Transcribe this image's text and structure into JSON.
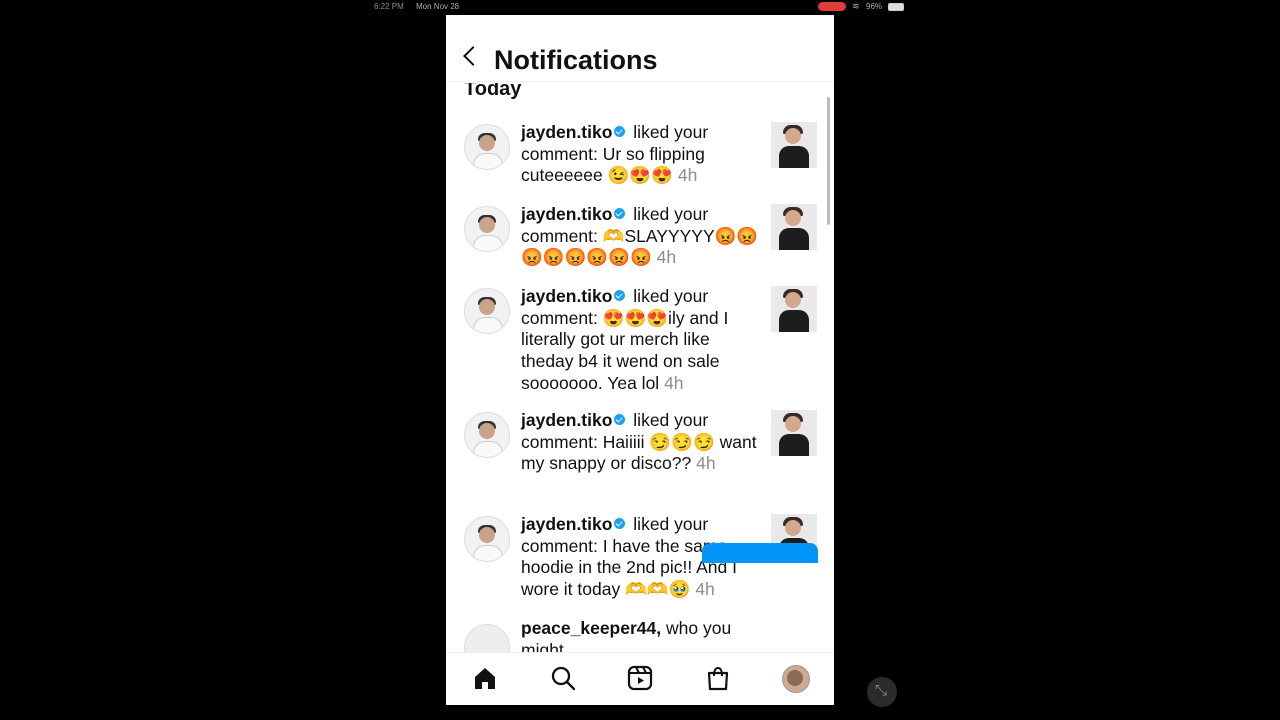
{
  "status_bar": {
    "time": "6:22 PM",
    "date": "Mon Nov 28",
    "battery": "96%"
  },
  "header": {
    "title": "Notifications"
  },
  "section": {
    "title": "Today"
  },
  "notifications": [
    {
      "username": "jayden.tiko",
      "action": "liked your comment: Ur so flipping cuteeeeee 😉😍😍",
      "time": "4h"
    },
    {
      "username": "jayden.tiko",
      "action": "liked your comment: 🫶SLAYYYYY😡😡😡😡😡😡😡😡",
      "time": "4h"
    },
    {
      "username": "jayden.tiko",
      "action": "liked your comment: 😍😍😍ily and I literally got ur merch like theday b4 it wend on sale sooooooo. Yea lol",
      "time": "4h"
    },
    {
      "username": "jayden.tiko",
      "action": "liked your comment: Haiiiii 😏😏😏 want my snappy or disco??",
      "time": "4h"
    },
    {
      "username": "jayden.tiko",
      "action": "liked your comment: I have the same hoodie in the 2nd pic!! And I wore it today 🫶🫶🥹",
      "time": "4h"
    },
    {
      "username": "peace_keeper44,",
      "action": "who you might",
      "time": ""
    }
  ],
  "tabbar": {
    "items": [
      "home-icon",
      "search-icon",
      "reels-icon",
      "shop-icon",
      "profile-avatar"
    ]
  },
  "colors": {
    "accent": "#0095f6",
    "verified": "#1da1f2"
  }
}
